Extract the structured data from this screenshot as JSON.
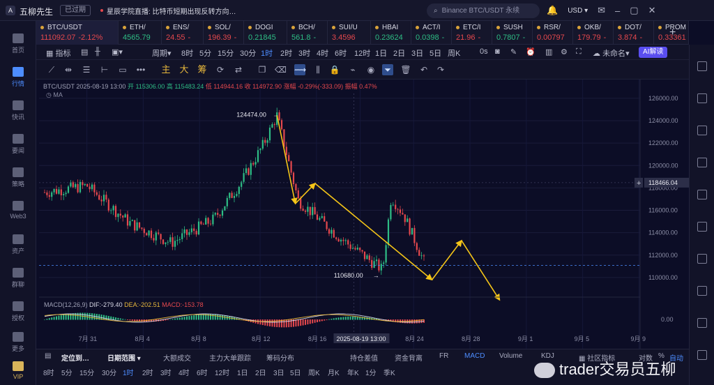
{
  "app": {
    "title": "五柳先生",
    "expired": "已过期"
  },
  "news": {
    "text": "星辰学院直播: 比特币短期出现反转方向…"
  },
  "search": {
    "placeholder": "Binance BTC/USDT 永续"
  },
  "currency": "USD",
  "sidebar": [
    {
      "label": "首页"
    },
    {
      "label": "行情"
    },
    {
      "label": "快讯"
    },
    {
      "label": "要闻"
    },
    {
      "label": "策略"
    },
    {
      "label": "Web3"
    },
    {
      "label": "资产"
    },
    {
      "label": "群聊"
    },
    {
      "label": "授权"
    },
    {
      "label": "更多"
    },
    {
      "label": "VIP"
    }
  ],
  "tickers": [
    {
      "name": "BTC/USDT",
      "price": "111092.07",
      "change": "-2.12%",
      "color": "#e5484d"
    },
    {
      "name": "ETH/",
      "price": "4565.79",
      "change": "",
      "color": "#2ebd85"
    },
    {
      "name": "ENS/",
      "price": "24.55",
      "change": "-",
      "color": "#e5484d"
    },
    {
      "name": "SOL/",
      "price": "196.39",
      "change": "-",
      "color": "#e5484d"
    },
    {
      "name": "DOGI",
      "price": "0.21845",
      "change": "",
      "color": "#2ebd85"
    },
    {
      "name": "BCH/",
      "price": "561.8",
      "change": "-",
      "color": "#2ebd85"
    },
    {
      "name": "SUI/U",
      "price": "3.4596",
      "change": "",
      "color": "#e5484d"
    },
    {
      "name": "HBAI",
      "price": "0.23624",
      "change": "",
      "color": "#2ebd85"
    },
    {
      "name": "ACT/I",
      "price": "0.0398",
      "change": "-",
      "color": "#2ebd85"
    },
    {
      "name": "ETC/I",
      "price": "21.96",
      "change": "-",
      "color": "#e5484d"
    },
    {
      "name": "SUSH",
      "price": "0.7807",
      "change": "-",
      "color": "#2ebd85"
    },
    {
      "name": "RSR/",
      "price": "0.00797",
      "change": "",
      "color": "#e5484d"
    },
    {
      "name": "OKB/",
      "price": "179.79",
      "change": "-",
      "color": "#e5484d"
    },
    {
      "name": "DOT/",
      "price": "3.874",
      "change": "-",
      "color": "#e5484d"
    },
    {
      "name": "PROM",
      "price": "0.33361",
      "change": "",
      "color": "#e5484d"
    }
  ],
  "toolbar1": {
    "indicators": "指标",
    "period": "周期",
    "periods": [
      "8时",
      "5分",
      "15分",
      "30分",
      "1时",
      "2时",
      "3时",
      "4时",
      "6时",
      "12时",
      "1日",
      "2日",
      "3日",
      "5日",
      "周K"
    ],
    "active_period": "1时",
    "zero_s": "0s",
    "unnamed": "未命名",
    "ai": "AI解读"
  },
  "toolbar2": {
    "main": "主",
    "big": "大",
    "chip": "筹"
  },
  "info": {
    "symbol": "BTC/USDT",
    "time": "2025-08-19 13:00",
    "open": "开 115306.00",
    "high": "高 115483.24",
    "low": "低 114944.16",
    "close": "收 114972.90",
    "change": "涨幅 -0.29%(-333.09)",
    "amp": "振幅 0.47%",
    "ma": "MA"
  },
  "macd": {
    "name": "MACD(12,26,9)",
    "dif": "DIF:-279.40",
    "dea": "DEA:-202.51",
    "macd": "MACD:-153.78"
  },
  "colors": {
    "up": "#2ebd85",
    "down": "#e5484d",
    "arrow": "#f5c518",
    "accent": "#4d8dff"
  },
  "chart_data": {
    "type": "candlestick",
    "symbol": "BTC/USDT",
    "interval": "1时",
    "ylim": [
      109000,
      126800
    ],
    "yticks": [
      "126000.00",
      "124000.00",
      "122000.00",
      "120000.00",
      "118000.00",
      "116000.00",
      "114000.00",
      "112000.00",
      "110000.00"
    ],
    "ytick_values": [
      126000,
      124000,
      122000,
      120000,
      118000,
      116000,
      114000,
      112000,
      110000
    ],
    "xticks": [
      "7月 31",
      "8月 4",
      "8月 8",
      "8月 12",
      "8月 16",
      "2025-08-19 13:00",
      "8月 24",
      "8月 28",
      "9月 1",
      "9月 5",
      "9月 9"
    ],
    "current_price": "118466.04",
    "current_price_value": 118466.04,
    "high_label": "124474.00",
    "high_value": 124474,
    "low_label": "110680.00",
    "low_value": 110680,
    "macd_zero": "0.00",
    "path_points_days": [
      0,
      3,
      6,
      9,
      12,
      14,
      15.5,
      16.5,
      18,
      21,
      24,
      24.6,
      25.5,
      27
    ],
    "price_path": [
      117600,
      118200,
      114900,
      113100,
      115200,
      118600,
      121800,
      124474,
      116900,
      113500,
      110680,
      117200,
      115600,
      111200
    ],
    "projection": [
      {
        "from": [
          16.5,
          124474
        ],
        "to": [
          17.8,
          116600
        ]
      },
      {
        "from": [
          17.8,
          116600
        ],
        "to": [
          19.2,
          118400
        ]
      },
      {
        "from": [
          19.2,
          118400
        ],
        "to": [
          27.5,
          109800
        ]
      },
      {
        "from": [
          27.5,
          109800
        ],
        "to": [
          29.6,
          113300
        ]
      },
      {
        "from": [
          29.6,
          113300
        ],
        "to": [
          32.3,
          108000
        ]
      }
    ]
  },
  "bottom1": {
    "locate": "定位到…",
    "daterange": "日期范围",
    "tabs": [
      "大额成交",
      "主力大单跟踪",
      "筹码分布",
      "持仓差值",
      "资金背离",
      "FR",
      "MACD",
      "Volume",
      "KDJ"
    ],
    "active_tab": "MACD",
    "community": "社区指标",
    "log": "对数",
    "pct": "%",
    "auto": "自动"
  },
  "bottom2": {
    "periods": [
      "8时",
      "5分",
      "15分",
      "30分",
      "1时",
      "2时",
      "3时",
      "4时",
      "6时",
      "12时",
      "1日",
      "2日",
      "3日",
      "5日",
      "周K",
      "月K",
      "年K",
      "1分",
      "季K"
    ]
  },
  "watermark": {
    "text": "trader交易员五柳"
  }
}
